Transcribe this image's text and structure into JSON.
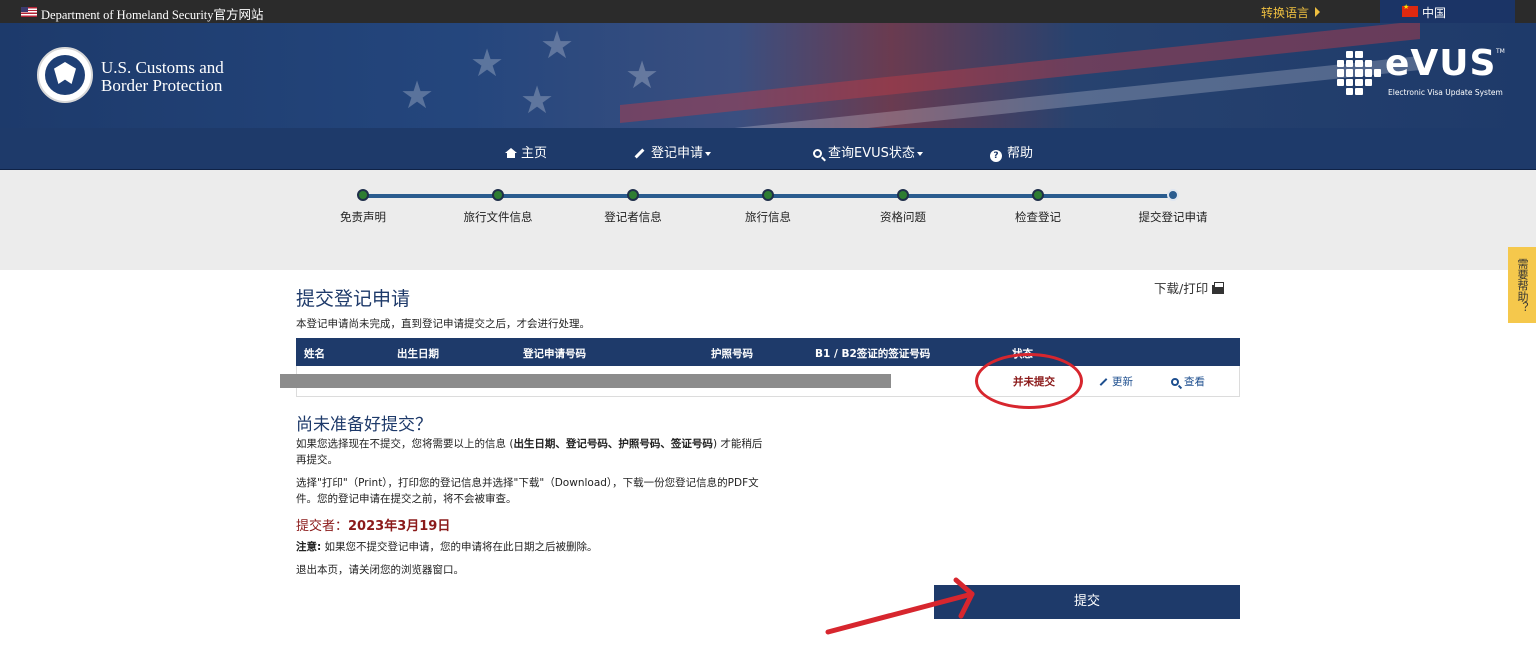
{
  "topbar": {
    "dhs_label": "Department of Homeland Security官方网站",
    "language_label": "转换语言",
    "country_label": "中国"
  },
  "header": {
    "agency_line1": "U.S. Customs and",
    "agency_line2": "Border Protection",
    "evus_logo": "eVUS",
    "evus_subtitle": "Electronic Visa Update System",
    "evus_tm": "TM"
  },
  "nav": {
    "items": [
      {
        "label": "主页",
        "icon": "home-icon"
      },
      {
        "label": "登记申请",
        "icon": "pencil-icon"
      },
      {
        "label": "查询EVUS状态",
        "icon": "search-icon"
      },
      {
        "label": "帮助",
        "icon": "help-icon"
      }
    ]
  },
  "progress": {
    "steps": [
      "免责声明",
      "旅行文件信息",
      "登记者信息",
      "旅行信息",
      "资格问题",
      "检查登记",
      "提交登记申请"
    ],
    "current_step": 7
  },
  "help_tab": "需要帮助？",
  "page": {
    "title": "提交登记申请",
    "download_label": "下载/打印",
    "description": "本登记申请尚未完成，直到登记申请提交之后，才会进行处理。"
  },
  "table": {
    "headers": [
      "姓名",
      "出生日期",
      "登记申请号码",
      "护照号码",
      "B1 / B2签证的签证号码",
      "状态"
    ],
    "row": {
      "status": "并未提交",
      "update_label": "更新",
      "view_label": "查看"
    }
  },
  "not_ready": {
    "title": "尚未准备好提交？",
    "para1_before": "如果您选择现在不提交，您将需要以上的信息 (",
    "para1_bold": "出生日期、登记号码、护照号码、签证号码",
    "para1_after": ") 才能稍后再提交。",
    "para2": "选择\"打印\"（Print），打印您的登记信息并选择\"下载\"（Download），下载一份您登记信息的PDF文件。您的登记申请在提交之前，将不会被审查。",
    "submitter_label": "提交者：",
    "submitter_date": "2023年3月19日",
    "note_label": "注意:",
    "note_text": "如果您不提交登记申请，您的申请将在此日期之后被删除。",
    "exit_text": "退出本页，请关闭您的浏览器窗口。"
  },
  "submit_button": "提交",
  "colors": {
    "navy": "#1e3a6a",
    "status_red": "#8b1a1a",
    "annotation_red": "#d7262e",
    "step_green": "#2e7d32",
    "help_yellow": "#f5c84c"
  }
}
